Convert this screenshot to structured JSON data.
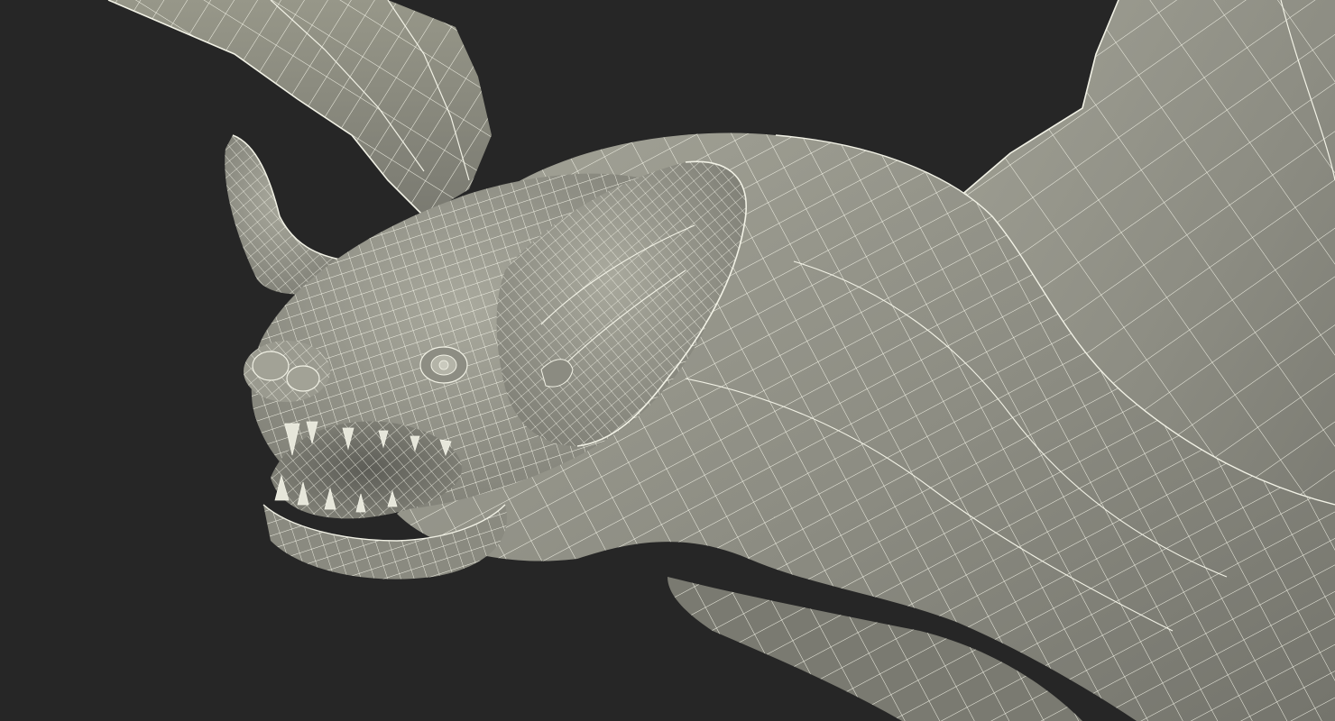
{
  "scene": {
    "background_color": "#262626",
    "mesh_fill_color": "#8e8e84",
    "mesh_shadow_color": "#6f6f67",
    "mesh_highlight_color": "#a6a69a",
    "wire_color": "#f2f2e6",
    "subject": "bat-wireframe-model"
  }
}
